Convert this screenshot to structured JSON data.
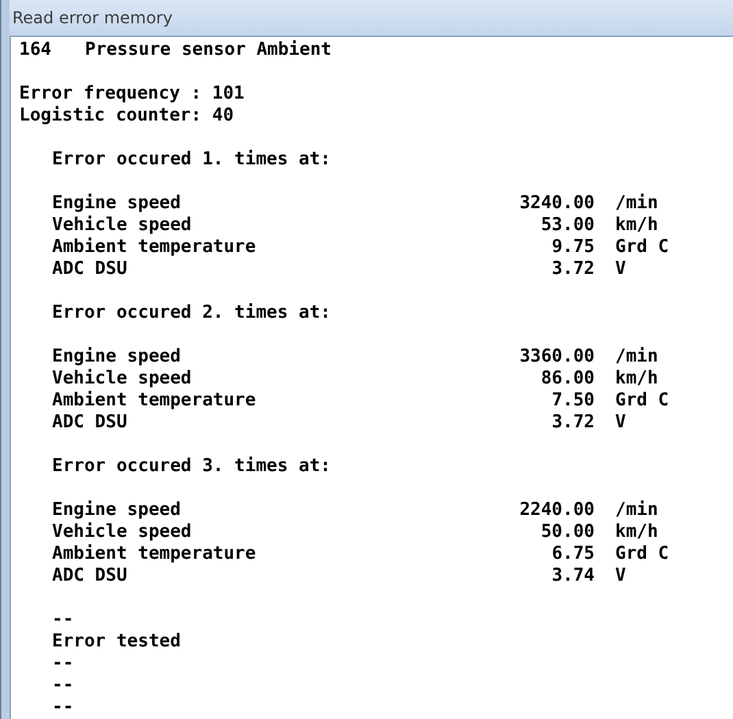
{
  "window": {
    "title": "Read error memory"
  },
  "header": {
    "code": "164",
    "name": "Pressure sensor Ambient"
  },
  "summary": [
    "Error frequency : 101",
    "Logistic counter: 40"
  ],
  "occurrences": [
    {
      "heading": "Error occured 1. times at:",
      "values": [
        {
          "label": "Engine speed",
          "value": "3240.00",
          "unit": "/min"
        },
        {
          "label": "Vehicle speed",
          "value": "53.00",
          "unit": "km/h"
        },
        {
          "label": "Ambient temperature",
          "value": "9.75",
          "unit": "Grd C"
        },
        {
          "label": "ADC DSU",
          "value": "3.72",
          "unit": "V"
        }
      ]
    },
    {
      "heading": "Error occured 2. times at:",
      "values": [
        {
          "label": "Engine speed",
          "value": "3360.00",
          "unit": "/min"
        },
        {
          "label": "Vehicle speed",
          "value": "86.00",
          "unit": "km/h"
        },
        {
          "label": "Ambient temperature",
          "value": "7.50",
          "unit": "Grd C"
        },
        {
          "label": "ADC DSU",
          "value": "3.72",
          "unit": "V"
        }
      ]
    },
    {
      "heading": "Error occured 3. times at:",
      "values": [
        {
          "label": "Engine speed",
          "value": "2240.00",
          "unit": "/min"
        },
        {
          "label": "Vehicle speed",
          "value": "50.00",
          "unit": "km/h"
        },
        {
          "label": "Ambient temperature",
          "value": "6.75",
          "unit": "Grd C"
        },
        {
          "label": "ADC DSU",
          "value": "3.74",
          "unit": "V"
        }
      ]
    }
  ],
  "footer": [
    "--",
    "Error tested",
    "--",
    "--",
    "--"
  ]
}
